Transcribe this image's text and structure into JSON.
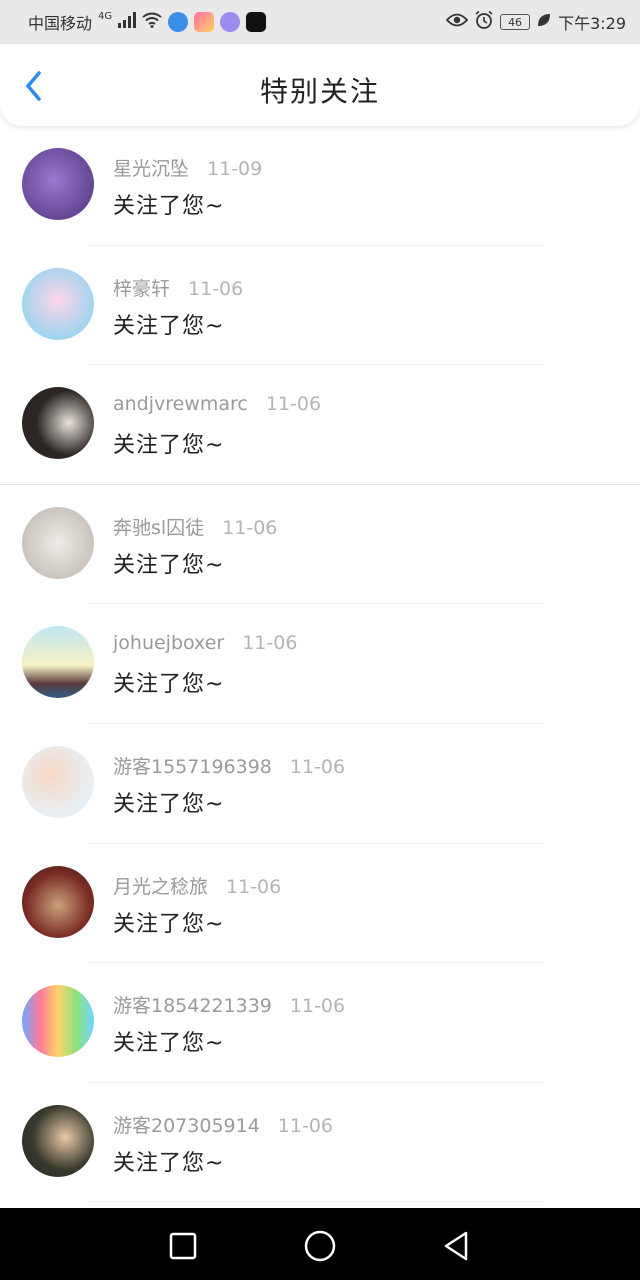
{
  "status_bar": {
    "carrier": "中国移动",
    "network": "4G",
    "battery": "46",
    "time": "下午3:29"
  },
  "header": {
    "title": "特别关注"
  },
  "items": [
    {
      "name": "星光沉坠",
      "date": "11-09",
      "message": "关注了您~"
    },
    {
      "name": "梓豪轩",
      "date": "11-06",
      "message": "关注了您~"
    },
    {
      "name": "andjvrewmarc",
      "date": "11-06",
      "message": "关注了您~"
    },
    {
      "name": "奔驰sl囚徒",
      "date": "11-06",
      "message": "关注了您~"
    },
    {
      "name": "johuejboxer",
      "date": "11-06",
      "message": "关注了您~"
    },
    {
      "name": "游客1557196398",
      "date": "11-06",
      "message": "关注了您~"
    },
    {
      "name": "月光之稔旅",
      "date": "11-06",
      "message": "关注了您~"
    },
    {
      "name": "游客1854221339",
      "date": "11-06",
      "message": "关注了您~"
    },
    {
      "name": "游客207305914",
      "date": "11-06",
      "message": "关注了您~"
    }
  ],
  "colors": {
    "accent": "#2a8cf0",
    "title": "#222222",
    "meta": "#9a9a9a"
  }
}
